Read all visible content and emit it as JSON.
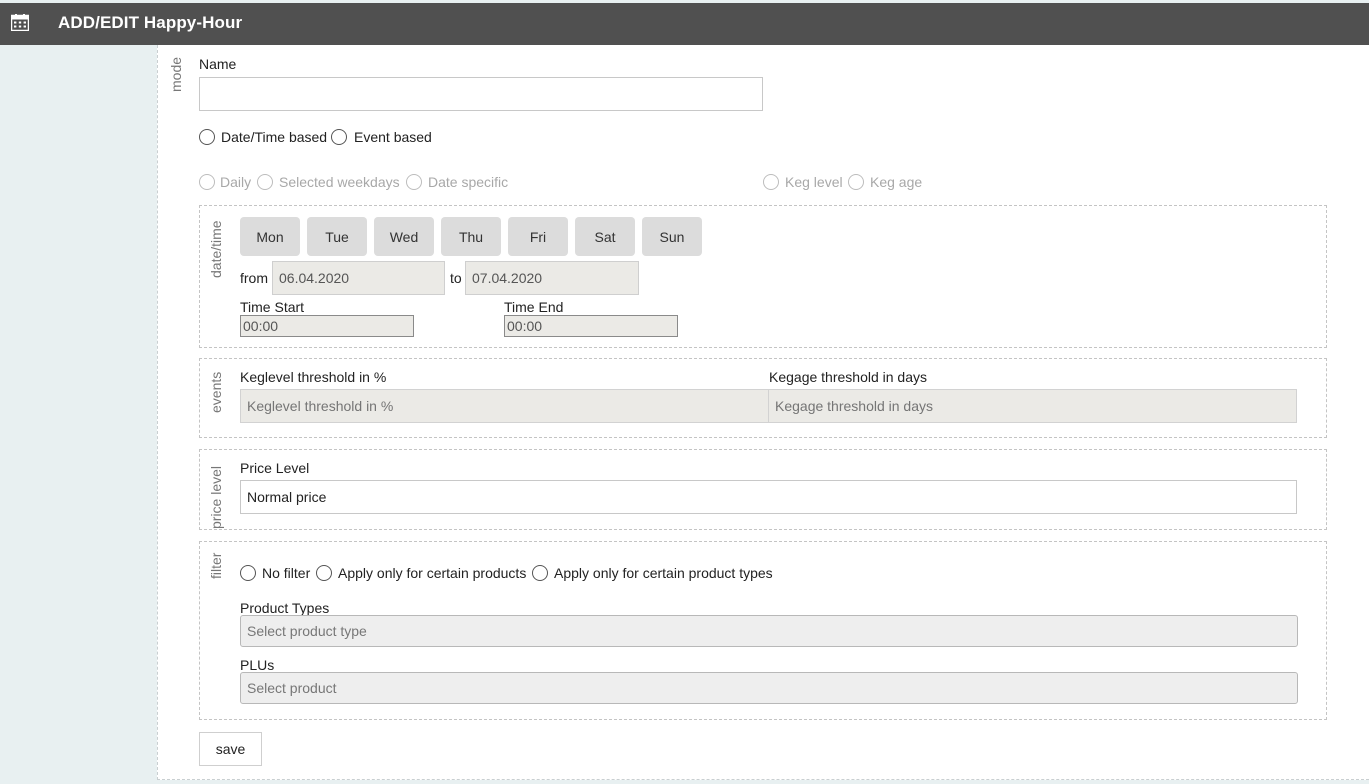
{
  "header": {
    "title": "ADD/EDIT Happy-Hour",
    "icon": "calendar-icon"
  },
  "mode": {
    "section_label": "mode",
    "name_label": "Name",
    "name_value": "",
    "type_options": [
      "Date/Time based",
      "Event based"
    ],
    "schedule_options": [
      "Daily",
      "Selected weekdays",
      "Date specific"
    ],
    "event_options": [
      "Keg level",
      "Keg age"
    ]
  },
  "datetime": {
    "section_label": "date/time",
    "weekdays": [
      "Mon",
      "Tue",
      "Wed",
      "Thu",
      "Fri",
      "Sat",
      "Sun"
    ],
    "from_label": "from",
    "from_value": "06.04.2020",
    "to_label": "to",
    "to_value": "07.04.2020",
    "time_start_label": "Time Start",
    "time_start_value": "00:00",
    "time_end_label": "Time End",
    "time_end_value": "00:00"
  },
  "events": {
    "section_label": "events",
    "keglevel_label": "Keglevel threshold in %",
    "keglevel_placeholder": "Keglevel threshold in %",
    "kegage_label": "Kegage threshold in days",
    "kegage_placeholder": "Kegage threshold in days"
  },
  "price": {
    "section_label": "price level",
    "price_level_label": "Price Level",
    "price_level_value": "Normal price"
  },
  "filter": {
    "section_label": "filter",
    "options": [
      "No filter",
      "Apply only for certain products",
      "Apply only for certain product types"
    ],
    "product_types_label": "Product Types",
    "product_types_placeholder": "Select product type",
    "plus_label": "PLUs",
    "plus_placeholder": "Select product"
  },
  "actions": {
    "save_label": "save"
  },
  "colors": {
    "header_bg": "#505050",
    "page_bg": "#e8f0f1",
    "day_button_bg": "#dcdcdc",
    "disabled_input_bg": "#ebeae6"
  }
}
